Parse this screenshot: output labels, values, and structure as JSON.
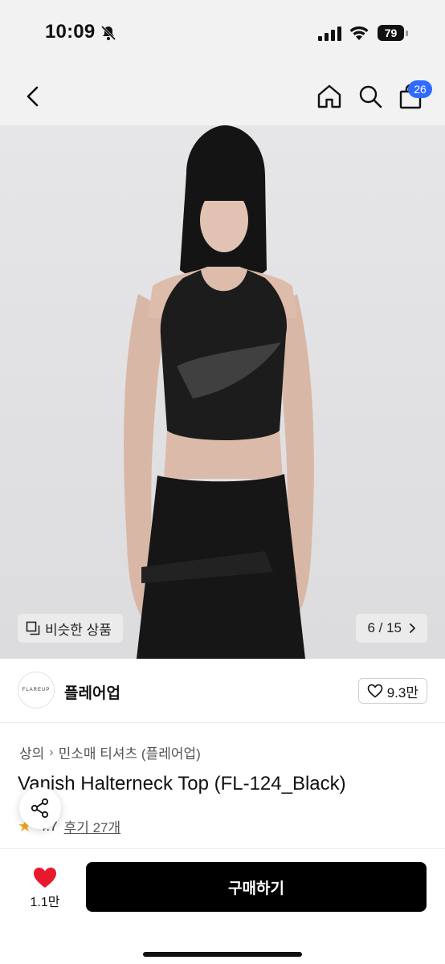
{
  "status": {
    "time": "10:09",
    "battery": "79"
  },
  "nav": {
    "cart_count": "26"
  },
  "hero": {
    "similar_label": "비슷한 상품",
    "page_counter": "6 / 15"
  },
  "brand": {
    "logo_text": "FLAREUP",
    "name": "플레어업",
    "likes": "9.3만"
  },
  "breadcrumb": {
    "items": [
      "상의",
      "민소매 티셔츠 (플레어업)"
    ]
  },
  "product": {
    "title": "Vanish Halterneck Top (FL-124_Black)",
    "rating": "4.7",
    "reviews": "후기 27개"
  },
  "bottom": {
    "wish_count": "1.1만",
    "buy_label": "구매하기"
  },
  "colors": {
    "accent_badge": "#2f6bff",
    "buy_button": "#000000",
    "heart": "#e8192c",
    "star": "#f5a623"
  },
  "icons": {
    "back": "chevron-left-icon",
    "home": "home-icon",
    "search": "search-icon",
    "cart": "shopping-bag-icon",
    "share": "share-icon",
    "like": "heart-outline-icon",
    "wish": "heart-filled-icon"
  }
}
